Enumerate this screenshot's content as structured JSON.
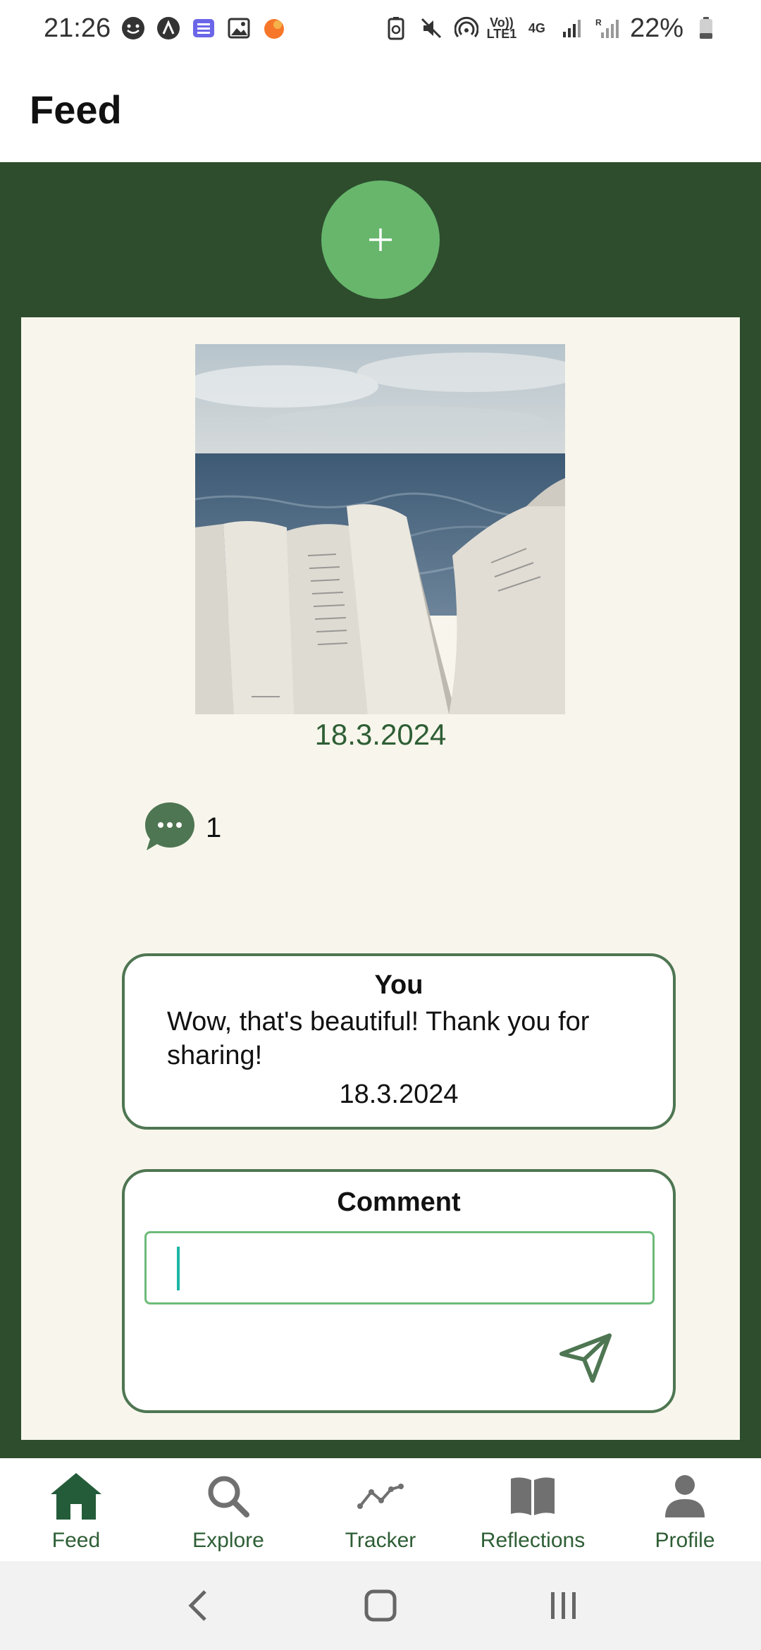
{
  "status_bar": {
    "time": "21:26",
    "battery_percent": "22%",
    "network_label": "4G",
    "volte_label": "Vo)) LTE1",
    "roaming_label": "R"
  },
  "header": {
    "title": "Feed"
  },
  "post": {
    "date": "18.3.2024",
    "comment_count": "1"
  },
  "comments": [
    {
      "author": "You",
      "text": "Wow, that's beautiful! Thank you for sharing!",
      "date": "18.3.2024"
    }
  ],
  "compose": {
    "label": "Comment",
    "value": ""
  },
  "bottom_nav": {
    "items": [
      {
        "label": "Feed",
        "icon": "home-icon",
        "active": true
      },
      {
        "label": "Explore",
        "icon": "search-icon",
        "active": false
      },
      {
        "label": "Tracker",
        "icon": "trend-line-icon",
        "active": false
      },
      {
        "label": "Reflections",
        "icon": "book-icon",
        "active": false
      },
      {
        "label": "Profile",
        "icon": "person-icon",
        "active": false
      }
    ]
  },
  "colors": {
    "accent_dark": "#2d4d2d",
    "accent_light": "#67b66c",
    "card_bg": "#f8f6ec",
    "active_nav": "#245c3a",
    "inactive_nav": "#707070"
  }
}
